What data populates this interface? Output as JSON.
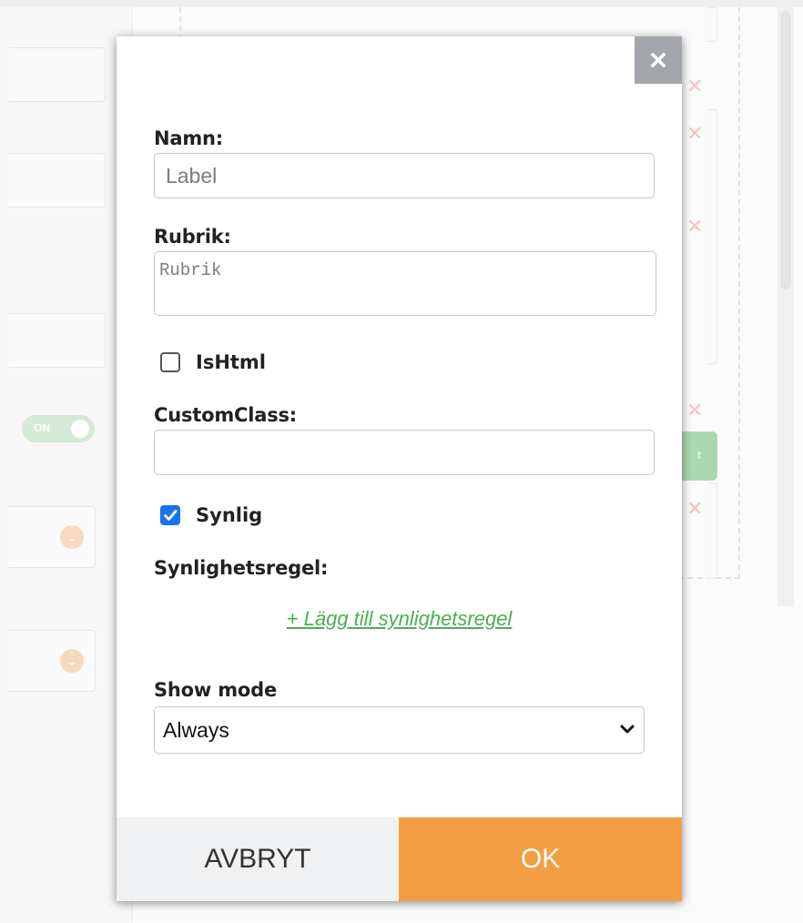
{
  "background": {
    "toggle_label": "ON"
  },
  "modal": {
    "name_label": "Namn:",
    "name_placeholder": "Label",
    "name_value": "",
    "heading_label": "Rubrik:",
    "heading_placeholder": "Rubrik",
    "heading_value": "",
    "ishtml_label": "IsHtml",
    "ishtml_checked": false,
    "customclass_label": "CustomClass:",
    "customclass_value": "",
    "visible_label": "Synlig",
    "visible_checked": true,
    "visibility_rule_label": "Synlighetsregel:",
    "add_rule_link": "+ Lägg till synlighetsregel",
    "show_mode_label": "Show mode",
    "show_mode_value": "Always",
    "cancel_label": "AVBRYT",
    "ok_label": "OK"
  },
  "colors": {
    "ok_button": "#f39e45",
    "cancel_button": "#f0f1f3",
    "close_button": "#a3a7ab",
    "link": "#4caf50",
    "checkbox_checked": "#1a73e8"
  },
  "icons": {
    "close": "close-icon",
    "select_arrow": "chevron-down-icon",
    "checkmark": "checkmark-icon"
  }
}
